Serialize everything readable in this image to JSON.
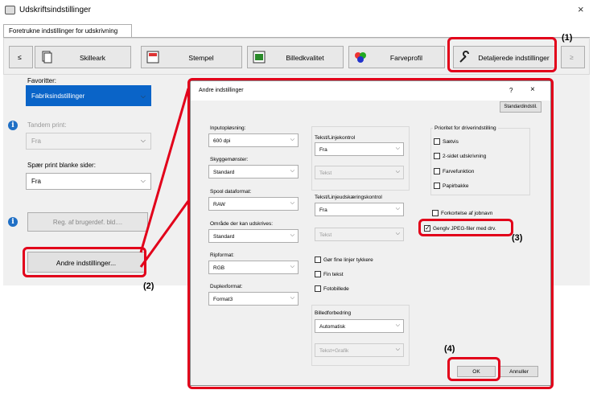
{
  "window": {
    "title": "Udskriftsindstillinger",
    "close_glyph": "×"
  },
  "tab": {
    "label": "Foretrukne indstillinger for udskrivning"
  },
  "toolbar": {
    "scroll_left": "≤",
    "scroll_right": "≥",
    "buttons": [
      {
        "label": "Skilleark",
        "icon": "pages-icon"
      },
      {
        "label": "Stempel",
        "icon": "stamp-icon"
      },
      {
        "label": "Billedkvalitet",
        "icon": "image-quality-icon"
      },
      {
        "label": "Farveprofil",
        "icon": "color-profile-icon"
      },
      {
        "label": "Detaljerede indstillinger",
        "icon": "wrench-icon"
      }
    ]
  },
  "left": {
    "favorites_label": "Favoritter:",
    "favorites_value": "Fabriksindstillinger",
    "tandem_label": "Tandem print:",
    "tandem_value": "Fra",
    "skip_blank_label": "Spær print blanke sider:",
    "skip_blank_value": "Fra",
    "reg_button": "Reg. af brugerdef. bld....",
    "other_button": "Andre indstillinger..."
  },
  "dialog": {
    "title": "Andre indstillinger",
    "help": "?",
    "close": "×",
    "default_button": "Standardindstil.",
    "input_resolution_label": "Inputopløsning:",
    "input_resolution_value": "600 dpi",
    "shade_pattern_label": "Skyggemønster:",
    "shade_pattern_value": "Standard",
    "spool_label": "Spool dataformat:",
    "spool_value": "RAW",
    "printable_area_label": "Område der kan udskrives:",
    "printable_area_value": "Standard",
    "rip_label": "Ripformat:",
    "rip_value": "RGB",
    "duplex_label": "Duplexformat:",
    "duplex_value": "Format3",
    "text_line_label": "Tekst/Linjekontrol",
    "text_line_value": "Fra",
    "text_line_sub_value": "Tekst",
    "text_edge_label": "Tekst/Linjeudskæringskontrol",
    "text_edge_value": "Fra",
    "text_edge_sub_value": "Tekst",
    "thin_lines": "Gør fine linjer tykkere",
    "fine_text": "Fin tekst",
    "photo_image": "Fotobillede",
    "image_improve_label": "Billedforbedring",
    "image_improve_value": "Automatisk",
    "image_improve_sub_value": "Tekst+Grafik",
    "priority_label": "Prioritet for driverindstilling",
    "priority_items": [
      "Sætvis",
      "2-sidet udskrivning",
      "Farvefunktion",
      "Papirbakke"
    ],
    "shorten_job": "Forkortelse af jobnavn",
    "mirror_jpeg": "Genglv JPEG-filer med drv.",
    "ok": "OK",
    "cancel": "Annuller"
  },
  "callouts": {
    "c1": "(1)",
    "c2": "(2)",
    "c3": "(3)",
    "c4": "(4)"
  },
  "colors": {
    "highlight": "#e2001a",
    "selection": "#0a64c8",
    "info": "#1f6fc5"
  }
}
